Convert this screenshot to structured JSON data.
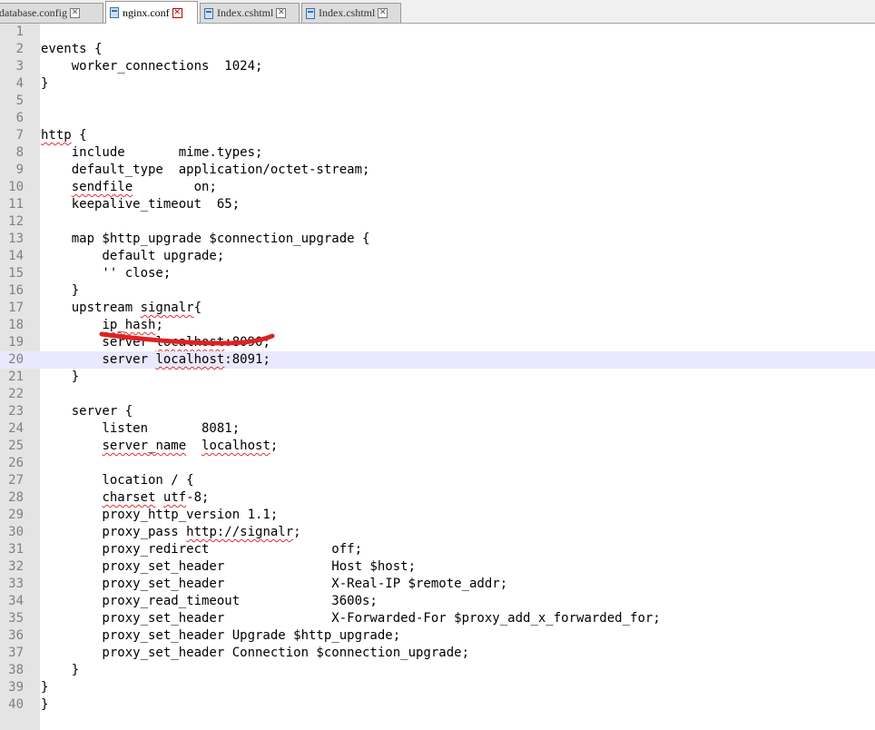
{
  "tabs": [
    {
      "label": "database.config",
      "active": false
    },
    {
      "label": "nginx.conf",
      "active": true
    },
    {
      "label": "Index.cshtml",
      "active": false
    },
    {
      "label": "Index.cshtml",
      "active": false
    }
  ],
  "current_line": 20,
  "lines": [
    {
      "n": "1",
      "text": ""
    },
    {
      "n": "2",
      "text": "events {"
    },
    {
      "n": "3",
      "text": "    worker_connections  1024;"
    },
    {
      "n": "4",
      "text": "}"
    },
    {
      "n": "5",
      "text": ""
    },
    {
      "n": "6",
      "text": ""
    },
    {
      "n": "7",
      "text": "http {"
    },
    {
      "n": "8",
      "text": "    include       mime.types;"
    },
    {
      "n": "9",
      "text": "    default_type  application/octet-stream;"
    },
    {
      "n": "10",
      "text": "    sendfile        on;"
    },
    {
      "n": "11",
      "text": "    keepalive_timeout  65;"
    },
    {
      "n": "12",
      "text": ""
    },
    {
      "n": "13",
      "text": "    map $http_upgrade $connection_upgrade {"
    },
    {
      "n": "14",
      "text": "        default upgrade;"
    },
    {
      "n": "15",
      "text": "        '' close;"
    },
    {
      "n": "16",
      "text": "    }"
    },
    {
      "n": "17",
      "text": "    upstream signalr{"
    },
    {
      "n": "18",
      "text": "        ip_hash;"
    },
    {
      "n": "19",
      "text": "        server localhost:8090;"
    },
    {
      "n": "20",
      "text": "        server localhost:8091;"
    },
    {
      "n": "21",
      "text": "    }"
    },
    {
      "n": "22",
      "text": ""
    },
    {
      "n": "23",
      "text": "    server {"
    },
    {
      "n": "24",
      "text": "        listen       8081;"
    },
    {
      "n": "25",
      "text": "        server_name  localhost;"
    },
    {
      "n": "26",
      "text": ""
    },
    {
      "n": "27",
      "text": "        location / {"
    },
    {
      "n": "28",
      "text": "        charset utf-8;"
    },
    {
      "n": "29",
      "text": "        proxy_http_version 1.1;"
    },
    {
      "n": "30",
      "text": "        proxy_pass http://signalr;"
    },
    {
      "n": "31",
      "text": "        proxy_redirect                off;"
    },
    {
      "n": "32",
      "text": "        proxy_set_header              Host $host;"
    },
    {
      "n": "33",
      "text": "        proxy_set_header              X-Real-IP $remote_addr;"
    },
    {
      "n": "34",
      "text": "        proxy_read_timeout            3600s;"
    },
    {
      "n": "35",
      "text": "        proxy_set_header              X-Forwarded-For $proxy_add_x_forwarded_for;"
    },
    {
      "n": "36",
      "text": "        proxy_set_header Upgrade $http_upgrade;"
    },
    {
      "n": "37",
      "text": "        proxy_set_header Connection $connection_upgrade;"
    },
    {
      "n": "38",
      "text": "    }"
    },
    {
      "n": "39",
      "text": "}"
    },
    {
      "n": "40",
      "text": "}"
    }
  ],
  "spell_marked_words": [
    "http",
    "sendfile",
    "signalr",
    "ip_hash",
    "localhost",
    "server_name",
    "charset",
    "utf",
    "http://signalr"
  ],
  "annotation": {
    "color": "#e02020",
    "target_line": 18
  }
}
